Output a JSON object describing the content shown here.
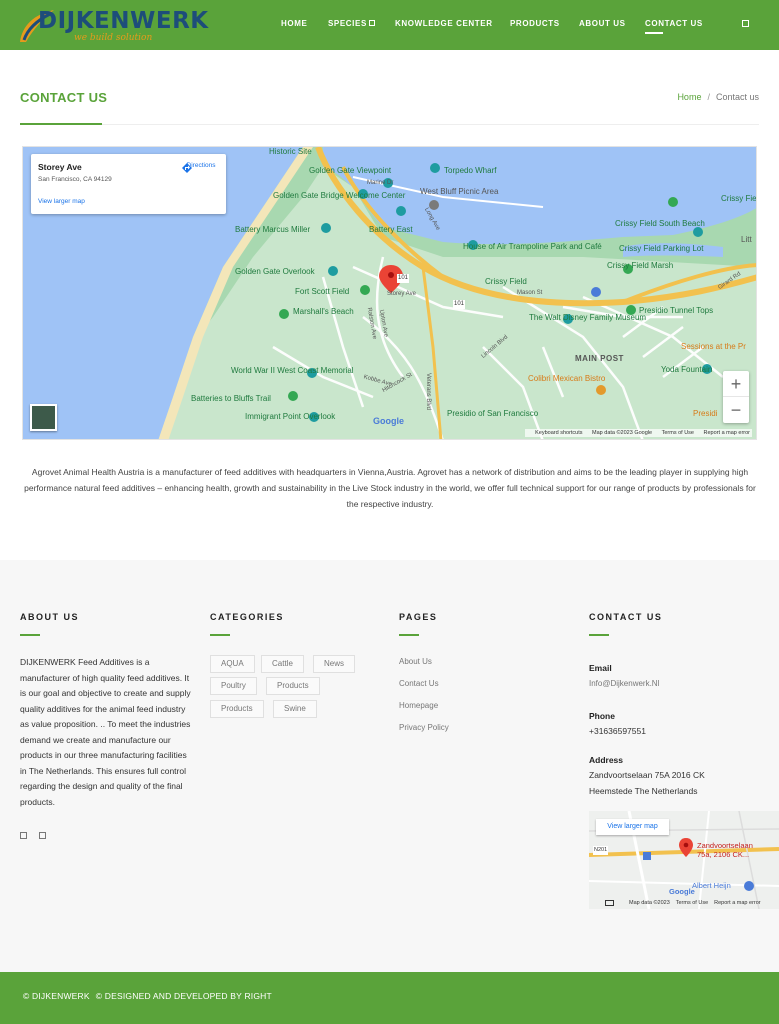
{
  "brand": {
    "name": "DIJKENWERK",
    "tagline": "we build solution",
    "colors": {
      "primary": "#5aa33a",
      "logo_blue": "#1d4d7a",
      "logo_orange": "#e59b1c"
    }
  },
  "nav": {
    "items": [
      {
        "label": "HOME"
      },
      {
        "label": "SPECIES",
        "has_dropdown": true
      },
      {
        "label": "KNOWLEDGE CENTER"
      },
      {
        "label": "PRODUCTS"
      },
      {
        "label": "ABOUT US"
      },
      {
        "label": "CONTACT US",
        "active": true
      }
    ],
    "search_icon": "search-icon"
  },
  "page": {
    "title": "CONTACT US",
    "breadcrumb": {
      "home": "Home",
      "separator": "/",
      "current": "Contact us"
    }
  },
  "map": {
    "place_name": "Storey Ave",
    "place_address": "San Francisco, CA 94129",
    "directions_label": "Directions",
    "larger_map_label": "View larger map",
    "zoom_in": "+",
    "zoom_out": "−",
    "google_label": "Google",
    "footer": {
      "shortcuts": "Keyboard shortcuts",
      "data": "Map data ©2023 Google",
      "terms": "Terms of Use",
      "report": "Report a map error"
    },
    "labels": {
      "historic_site": "Historic Site",
      "golden_gate_viewpoint": "Golden Gate Viewpoint",
      "torpedo_wharf": "Torpedo Wharf",
      "west_bluff": "West Bluff Picnic Area",
      "gg_welcome": "Golden Gate Bridge Welcome Center",
      "battery_marcus": "Battery Marcus Miller",
      "battery_east": "Battery East",
      "crissy_south": "Crissy Field South Beach",
      "crissy_east": "Crissy Field East Beach",
      "crissy_parking": "Crissy Field Parking Lot",
      "house_of_air": "House of Air Trampoline Park and Café",
      "gg_overlook": "Golden Gate Overlook",
      "crissy_field": "Crissy Field",
      "crissy_marsh": "Crissy Field Marsh",
      "fort_scott": "Fort Scott Field",
      "marshalls": "Marshall's Beach",
      "walt_disney": "The Walt Disney Family Museum",
      "presidio_tunnel": "Presidio Tunnel Tops",
      "main_post": "MAIN POST",
      "sessions": "Sessions at the Pr",
      "ww2": "World War II West Coast Memorial",
      "colibri": "Colibri Mexican Bistro",
      "yoda": "Yoda Fountain",
      "batteries_bluffs": "Batteries to Bluffs Trail",
      "immigrant": "Immigrant Point Overlook",
      "presidio_sf": "Presidio of San Francisco",
      "presid": "Presidi",
      "storey_ave": "Storey Ave",
      "veterans": "Veterans Blvd",
      "lincoln": "Lincoln Blvd",
      "mason": "Mason St",
      "girard": "Girard Rd",
      "long_ave": "Long Ave",
      "marine_dr": "Marine Dr",
      "upton": "Upton Ave",
      "ralston": "Ralston Ave",
      "kobbe": "Kobbe Ave",
      "hitchcock": "Hitchcock St",
      "r101a": "101",
      "r101b": "101",
      "litt": "Litt"
    }
  },
  "intro": "Agrovet Animal Health Austria is a manufacturer of feed additives with headquarters in Vienna,Austria. Agrovet has a network of distribution and aims to be the leading player in supplying high performance natural feed additives – enhancing health, growth and sustainability in the Live Stock industry in the world, we offer full technical support for our range of products by professionals for the respective industry.",
  "footer": {
    "about": {
      "heading": "ABOUT US",
      "text": "DIJKENWERK Feed Additives is a manufacturer of high quality feed additives. It is our goal and objective to create and supply quality additives for the animal feed industry as value proposition. .. To meet the industries demand we create and manufacture our products in our three manufacturing facilities in The Netherlands. This ensures full control regarding the design and quality of the final products."
    },
    "categories": {
      "heading": "CATEGORIES",
      "tags": [
        "AQUA",
        "Cattle",
        "News",
        "Poultry",
        "Products",
        "Products",
        "Swine"
      ]
    },
    "pages": {
      "heading": "PAGES",
      "links": [
        "About Us",
        "Contact Us",
        "Homepage",
        "Privacy Policy"
      ]
    },
    "contact": {
      "heading": "CONTACT US",
      "email_label": "Email",
      "email": "Info@Dijkenwerk.Nl",
      "phone_label": "Phone",
      "phone": "+31636597551",
      "address_label": "Address",
      "address_line1": "Zandvoortselaan 75A 2016 CK",
      "address_line2": "Heemstede The Netherlands",
      "mini_map": {
        "larger_map_label": "View larger map",
        "pin_label_1": "Zandvoortselaan",
        "pin_label_2": "75a, 2106 CK...",
        "road": "N201",
        "albert": "Albert Heijn",
        "google": "Google",
        "footer_data": "Map data ©2023",
        "footer_terms": "Terms of Use",
        "footer_report": "Report a map error"
      }
    }
  },
  "bottom": {
    "copyright": "© DIJKENWERK",
    "credit": "© DESIGNED AND DEVELOPED BY RIGHT"
  }
}
